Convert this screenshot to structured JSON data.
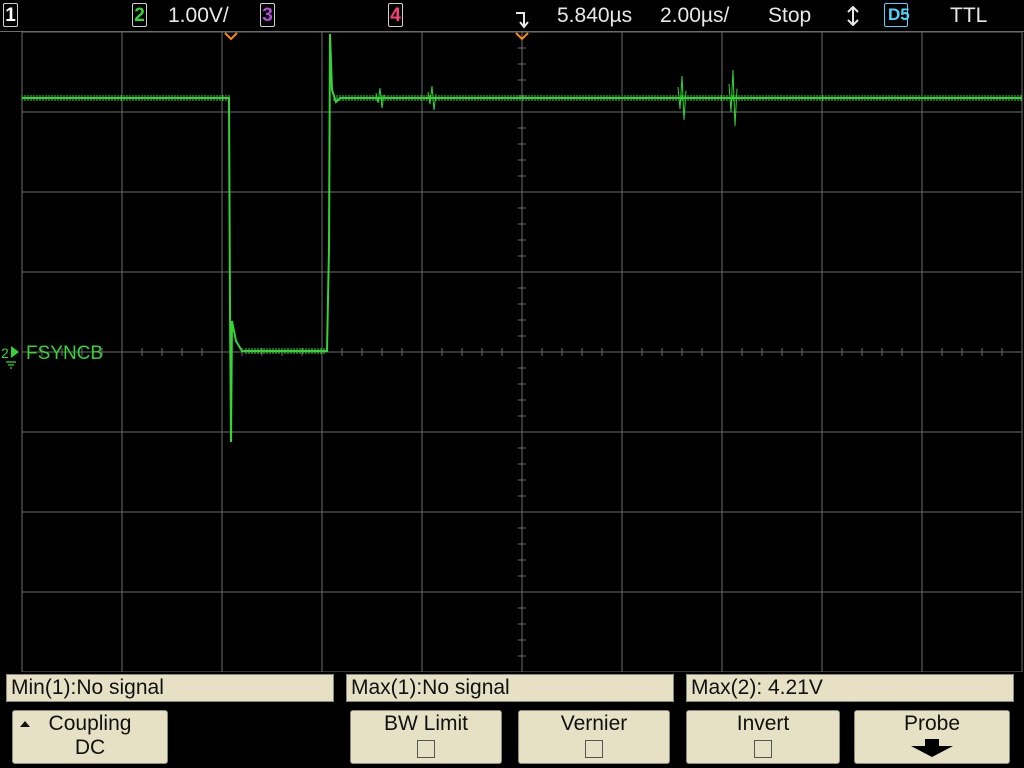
{
  "status_bar": {
    "ch1_label": "1",
    "ch2_label": "2",
    "ch2_scale": "1.00V/",
    "ch3_label": "3",
    "ch4_label": "4",
    "time_delay": "5.840µs",
    "time_scale": "2.00µs/",
    "run_state": "Stop",
    "trigger_source": "D5",
    "trigger_level": "TTL"
  },
  "colors": {
    "ch1": "#f5e400",
    "ch2": "#33d433",
    "ch3": "#b44bd9",
    "ch4": "#ff3d7a",
    "digital": "#4fd6ff",
    "grid": "#6b6b6b",
    "softkey_bg": "#e6e1c4"
  },
  "waveform": {
    "label": "FSYNCB",
    "channel_marker": "2"
  },
  "measurements": [
    {
      "text": "Min(1):No signal"
    },
    {
      "text": "Max(1):No signal"
    },
    {
      "text": "Max(2): 4.21V"
    }
  ],
  "softkeys": {
    "coupling": {
      "label": "Coupling",
      "value": "DC"
    },
    "bw_limit": {
      "label": "BW Limit",
      "checked": false
    },
    "vernier": {
      "label": "Vernier",
      "checked": false
    },
    "invert": {
      "label": "Invert",
      "checked": false
    },
    "probe": {
      "label": "Probe"
    }
  },
  "icons": {
    "trigger_edge": "falling-edge-trigger-icon",
    "trigger_mode": "up-down-arrow-icon",
    "probe_menu": "down-arrow-icon"
  }
}
